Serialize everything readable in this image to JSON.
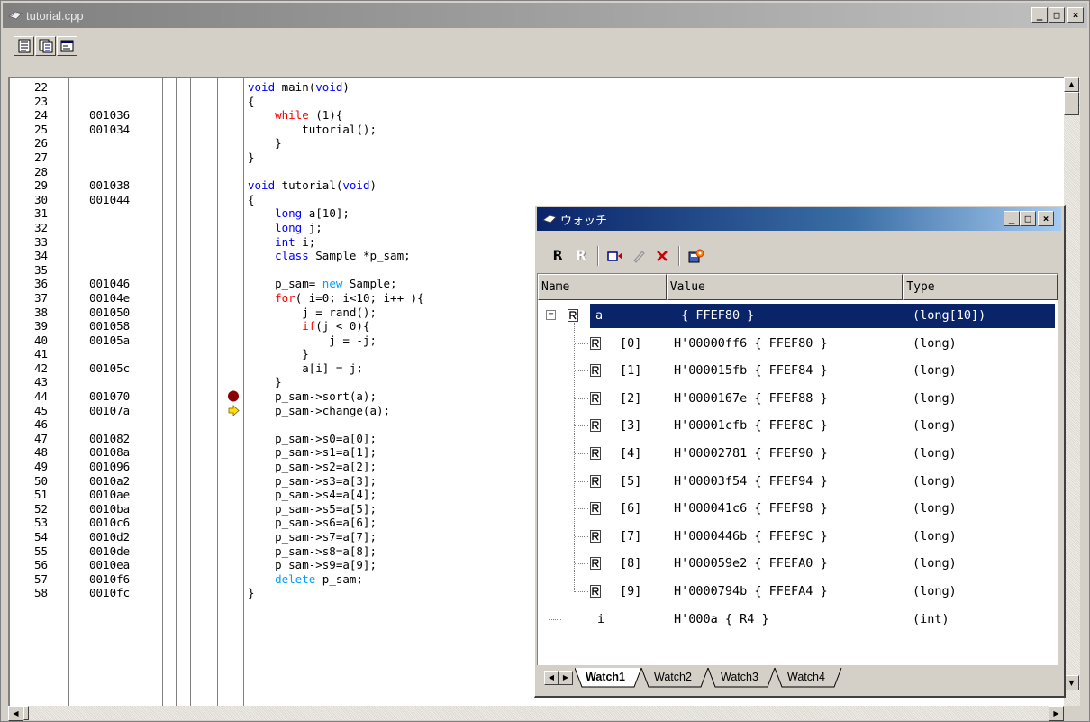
{
  "editor_window": {
    "title": "tutorial.cpp",
    "min_glyph": "_",
    "max_glyph": "□",
    "close_glyph": "×",
    "toolbar_icons": [
      "source-view-icon",
      "mixed-view-icon",
      "disassembly-view-icon"
    ]
  },
  "source": {
    "lines": [
      {
        "n": "22",
        "addr": "",
        "code": [
          {
            "t": "void",
            "c": "kw"
          },
          {
            "t": " main("
          },
          {
            "t": "void",
            "c": "kw"
          },
          {
            "t": ")"
          }
        ]
      },
      {
        "n": "23",
        "addr": "",
        "code": [
          {
            "t": "{"
          }
        ]
      },
      {
        "n": "24",
        "addr": "001036",
        "code": [
          {
            "t": "    "
          },
          {
            "t": "while",
            "c": "kw2"
          },
          {
            "t": " (1){"
          }
        ]
      },
      {
        "n": "25",
        "addr": "001034",
        "code": [
          {
            "t": "        tutorial();"
          }
        ]
      },
      {
        "n": "26",
        "addr": "",
        "code": [
          {
            "t": "    }"
          }
        ]
      },
      {
        "n": "27",
        "addr": "",
        "code": [
          {
            "t": "}"
          }
        ]
      },
      {
        "n": "28",
        "addr": "",
        "code": []
      },
      {
        "n": "29",
        "addr": "001038",
        "code": [
          {
            "t": "void",
            "c": "kw"
          },
          {
            "t": " tutorial("
          },
          {
            "t": "void",
            "c": "kw"
          },
          {
            "t": ")"
          }
        ]
      },
      {
        "n": "30",
        "addr": "001044",
        "code": [
          {
            "t": "{"
          }
        ]
      },
      {
        "n": "31",
        "addr": "",
        "code": [
          {
            "t": "    "
          },
          {
            "t": "long",
            "c": "kw"
          },
          {
            "t": " a[10];"
          }
        ]
      },
      {
        "n": "32",
        "addr": "",
        "code": [
          {
            "t": "    "
          },
          {
            "t": "long",
            "c": "kw"
          },
          {
            "t": " j;"
          }
        ]
      },
      {
        "n": "33",
        "addr": "",
        "code": [
          {
            "t": "    "
          },
          {
            "t": "int",
            "c": "kw"
          },
          {
            "t": " i;"
          }
        ]
      },
      {
        "n": "34",
        "addr": "",
        "code": [
          {
            "t": "    "
          },
          {
            "t": "class",
            "c": "kw"
          },
          {
            "t": " Sample *p_sam;"
          }
        ]
      },
      {
        "n": "35",
        "addr": "",
        "code": []
      },
      {
        "n": "36",
        "addr": "001046",
        "code": [
          {
            "t": "    p_sam= "
          },
          {
            "t": "new",
            "c": "kw3"
          },
          {
            "t": " Sample;"
          }
        ]
      },
      {
        "n": "37",
        "addr": "00104e",
        "code": [
          {
            "t": "    "
          },
          {
            "t": "for",
            "c": "kw2"
          },
          {
            "t": "( i=0; i<10; i++ ){"
          }
        ]
      },
      {
        "n": "38",
        "addr": "001050",
        "code": [
          {
            "t": "        j = rand();"
          }
        ]
      },
      {
        "n": "39",
        "addr": "001058",
        "code": [
          {
            "t": "        "
          },
          {
            "t": "if",
            "c": "kw2"
          },
          {
            "t": "(j < 0){"
          }
        ]
      },
      {
        "n": "40",
        "addr": "00105a",
        "code": [
          {
            "t": "            j = -j;"
          }
        ]
      },
      {
        "n": "41",
        "addr": "",
        "code": [
          {
            "t": "        }"
          }
        ]
      },
      {
        "n": "42",
        "addr": "00105c",
        "code": [
          {
            "t": "        a[i] = j;"
          }
        ]
      },
      {
        "n": "43",
        "addr": "",
        "code": [
          {
            "t": "    }"
          }
        ]
      },
      {
        "n": "44",
        "addr": "001070",
        "mark": "breakpoint",
        "code": [
          {
            "t": "    p_sam->sort(a);"
          }
        ]
      },
      {
        "n": "45",
        "addr": "00107a",
        "mark": "pc-arrow",
        "code": [
          {
            "t": "    p_sam->change(a);"
          }
        ]
      },
      {
        "n": "46",
        "addr": "",
        "code": []
      },
      {
        "n": "47",
        "addr": "001082",
        "code": [
          {
            "t": "    p_sam->s0=a[0];"
          }
        ]
      },
      {
        "n": "48",
        "addr": "00108a",
        "code": [
          {
            "t": "    p_sam->s1=a[1];"
          }
        ]
      },
      {
        "n": "49",
        "addr": "001096",
        "code": [
          {
            "t": "    p_sam->s2=a[2];"
          }
        ]
      },
      {
        "n": "50",
        "addr": "0010a2",
        "code": [
          {
            "t": "    p_sam->s3=a[3];"
          }
        ]
      },
      {
        "n": "51",
        "addr": "0010ae",
        "code": [
          {
            "t": "    p_sam->s4=a[4];"
          }
        ]
      },
      {
        "n": "52",
        "addr": "0010ba",
        "code": [
          {
            "t": "    p_sam->s5=a[5];"
          }
        ]
      },
      {
        "n": "53",
        "addr": "0010c6",
        "code": [
          {
            "t": "    p_sam->s6=a[6];"
          }
        ]
      },
      {
        "n": "54",
        "addr": "0010d2",
        "code": [
          {
            "t": "    p_sam->s7=a[7];"
          }
        ]
      },
      {
        "n": "55",
        "addr": "0010de",
        "code": [
          {
            "t": "    p_sam->s8=a[8];"
          }
        ]
      },
      {
        "n": "56",
        "addr": "0010ea",
        "code": [
          {
            "t": "    p_sam->s9=a[9];"
          }
        ]
      },
      {
        "n": "57",
        "addr": "0010f6",
        "code": [
          {
            "t": "    "
          },
          {
            "t": "delete",
            "c": "kw3"
          },
          {
            "t": " p_sam;"
          }
        ]
      },
      {
        "n": "58",
        "addr": "0010fc",
        "code": [
          {
            "t": "}"
          }
        ]
      }
    ]
  },
  "watch_window": {
    "title": "ウォッチ",
    "min_glyph": "_",
    "max_glyph": "□",
    "close_glyph": "×",
    "toolbar_icons": [
      "radix-icon",
      "radix-disabled-icon",
      "add-watch-icon",
      "edit-icon",
      "delete-icon",
      "properties-icon"
    ],
    "columns": [
      "Name",
      "Value",
      "Type"
    ],
    "rows": [
      {
        "name": "a",
        "value": " { FFEF80 }",
        "type": "(long[10])",
        "level": 0,
        "expander": "−",
        "selected": true
      },
      {
        "name": "[0]",
        "value": "H'00000ff6 { FFEF80 }",
        "type": "(long)",
        "level": 1
      },
      {
        "name": "[1]",
        "value": "H'000015fb { FFEF84 }",
        "type": "(long)",
        "level": 1
      },
      {
        "name": "[2]",
        "value": "H'0000167e { FFEF88 }",
        "type": "(long)",
        "level": 1
      },
      {
        "name": "[3]",
        "value": "H'00001cfb { FFEF8C }",
        "type": "(long)",
        "level": 1
      },
      {
        "name": "[4]",
        "value": "H'00002781 { FFEF90 }",
        "type": "(long)",
        "level": 1
      },
      {
        "name": "[5]",
        "value": "H'00003f54 { FFEF94 }",
        "type": "(long)",
        "level": 1
      },
      {
        "name": "[6]",
        "value": "H'000041c6 { FFEF98 }",
        "type": "(long)",
        "level": 1
      },
      {
        "name": "[7]",
        "value": "H'0000446b { FFEF9C }",
        "type": "(long)",
        "level": 1
      },
      {
        "name": "[8]",
        "value": "H'000059e2 { FFEFA0 }",
        "type": "(long)",
        "level": 1
      },
      {
        "name": "[9]",
        "value": "H'0000794b { FFEFA4 }",
        "type": "(long)",
        "level": 1
      },
      {
        "name": "i",
        "value": "H'000a { R4 }",
        "type": "(int)",
        "level": 0,
        "plain": true
      }
    ],
    "tabs": [
      "Watch1",
      "Watch2",
      "Watch3",
      "Watch4"
    ],
    "active_tab": 0
  },
  "colors": {
    "keyword": "#0000ff",
    "control_keyword": "#ff0000",
    "operator_keyword": "#00a0ff",
    "selection": "#0a246a",
    "breakpoint": "#8b0000",
    "pc_arrow": "#ffe000"
  }
}
